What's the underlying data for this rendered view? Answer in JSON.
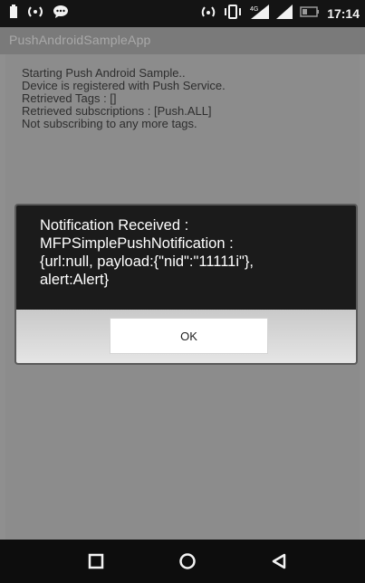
{
  "status_bar": {
    "left_icons": [
      "battery-icon",
      "wifi-hotspot-icon",
      "message-icon"
    ],
    "right_icons": [
      "nfc-icon",
      "vibrate-icon",
      "signal-4g-icon",
      "signal-icon",
      "battery-level-icon"
    ],
    "time": "17:14"
  },
  "app": {
    "title": "PushAndroidSampleApp"
  },
  "log": {
    "lines": [
      "Starting Push Android Sample..",
      "Device is registered with Push Service.",
      "Retrieved Tags : []",
      "Retrieved subscriptions : [Push.ALL]",
      "Not subscribing to any more tags."
    ]
  },
  "dialog": {
    "message_lines": [
      "Notification Received :",
      "MFPSimplePushNotification :",
      "{url:null, payload:{\"nid\":\"11111i\"},",
      "alert:Alert}"
    ],
    "ok_label": "OK"
  },
  "nav": {
    "buttons": [
      "recent-apps-icon",
      "home-icon",
      "back-icon"
    ]
  }
}
